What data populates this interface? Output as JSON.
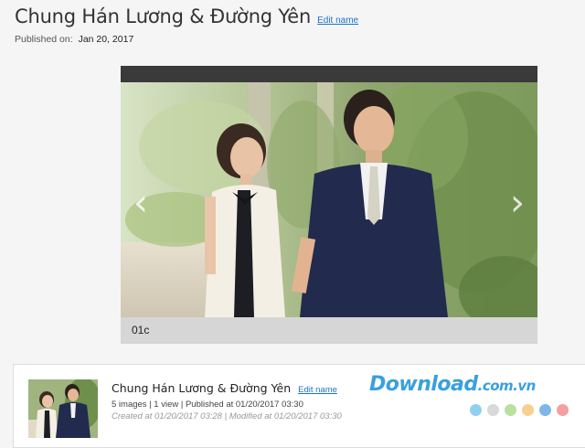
{
  "header": {
    "title": "Chung Hán Lương & Đường Yên",
    "edit_label": "Edit name",
    "published_label": "Published on:",
    "published_date": "Jan 20, 2017"
  },
  "slideshow": {
    "caption": "01c",
    "prev_icon": "chevron-left-icon",
    "next_icon": "chevron-right-icon",
    "prev_glyph": "‹",
    "next_glyph": "›"
  },
  "album_card": {
    "title": "Chung Hán Lương & Đường Yên",
    "edit_label": "Edit name",
    "meta": "5 images | 1 view | Published at 01/20/2017 03:30",
    "dates": "Created at 01/20/2017 03:28 | Modified at 01/20/2017 03:30"
  },
  "watermark": {
    "brand": "Download",
    "suffix": ".com.vn",
    "dot_colors": [
      "#8fd0ef",
      "#d9d9d9",
      "#b9e0a0",
      "#f7cf8f",
      "#7fb6ea",
      "#f2a0a0"
    ]
  }
}
